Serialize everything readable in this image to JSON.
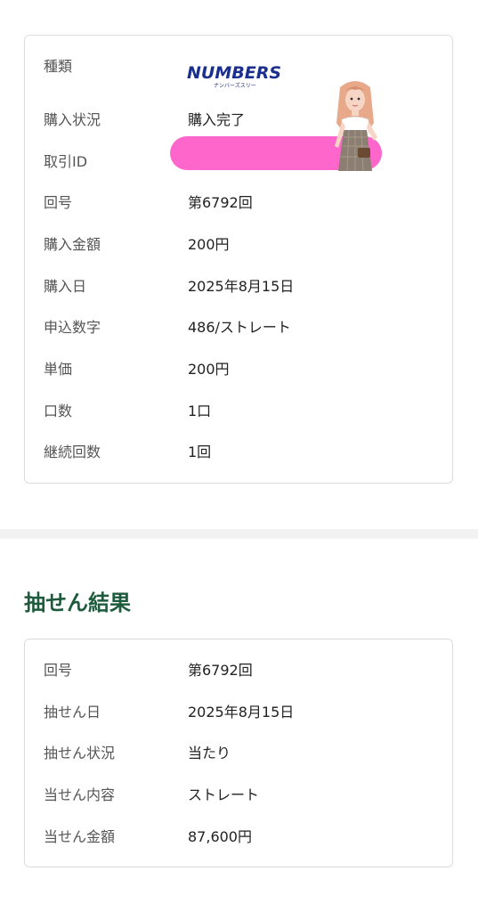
{
  "purchase": {
    "type_label": "種類",
    "logo_text": "NUMBERS3",
    "logo_sub": "ナンバーズスリー",
    "rows": [
      {
        "label": "購入状況",
        "value": "購入完了"
      },
      {
        "label": "取引ID",
        "value": ""
      },
      {
        "label": "回号",
        "value": "第6792回"
      },
      {
        "label": "購入金額",
        "value": "200円"
      },
      {
        "label": "購入日",
        "value": "2025年8月15日"
      },
      {
        "label": "申込数字",
        "value": "486/ストレート"
      },
      {
        "label": "単価",
        "value": "200円"
      },
      {
        "label": "口数",
        "value": "1口"
      },
      {
        "label": "継続回数",
        "value": "1回"
      }
    ]
  },
  "result": {
    "title": "抽せん結果",
    "rows": [
      {
        "label": "回号",
        "value": "第6792回"
      },
      {
        "label": "抽せん日",
        "value": "2025年8月15日"
      },
      {
        "label": "抽せん状況",
        "value": "当たり"
      },
      {
        "label": "当せん内容",
        "value": "ストレート"
      },
      {
        "label": "当せん金額",
        "value": "87,600円"
      }
    ]
  },
  "colors": {
    "title": "#1e5a3c",
    "redaction": "#ff66cc",
    "logo_blue": "#1b2f8f",
    "logo_red": "#e8392f"
  }
}
